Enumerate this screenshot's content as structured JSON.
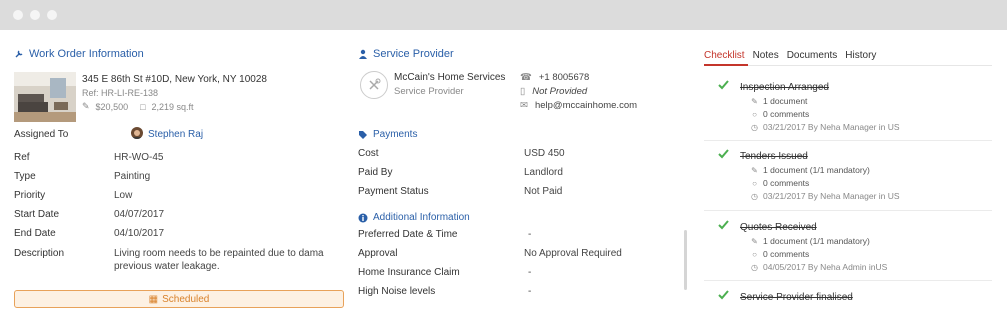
{
  "work_order": {
    "section_title": "Work Order Information",
    "address": "345 E 86th St #10D, New York, NY 10028",
    "ref_line": "Ref: HR-LI-RE-138",
    "price": "$20,500",
    "area": "2,219 sq.ft",
    "fields": [
      {
        "label": "Assigned To",
        "value": "Stephen Raj"
      },
      {
        "label": "Ref",
        "value": "HR-WO-45"
      },
      {
        "label": "Type",
        "value": "Painting"
      },
      {
        "label": "Priority",
        "value": "Low"
      },
      {
        "label": "Start Date",
        "value": "04/07/2017"
      },
      {
        "label": "End Date",
        "value": "04/10/2017"
      },
      {
        "label": "Description",
        "value": "Living room needs to be repainted due to damage fr",
        "value2": "previous water leakage."
      }
    ],
    "status_button": "Scheduled"
  },
  "service_provider": {
    "section_title": "Service Provider",
    "name": "McCain's Home Services",
    "role": "Service Provider",
    "phone": "+1 8005678",
    "mobile": "Not Provided",
    "email": "help@mccainhome.com"
  },
  "payments": {
    "section_title": "Payments",
    "rows": [
      {
        "label": "Cost",
        "value": "USD 450"
      },
      {
        "label": "Paid By",
        "value": "Landlord"
      },
      {
        "label": "Payment Status",
        "value": "Not Paid"
      }
    ]
  },
  "additional": {
    "section_title": "Additional Information",
    "rows": [
      {
        "label": "Preferred Date & Time",
        "value": "-"
      },
      {
        "label": "Approval",
        "value": "No Approval Required"
      },
      {
        "label": "Home Insurance Claim",
        "value": "-"
      },
      {
        "label": "High Noise levels",
        "value": "-"
      }
    ]
  },
  "tabs": [
    "Checklist",
    "Notes",
    "Documents",
    "History"
  ],
  "checklist": [
    {
      "title": "Inspection Arranged",
      "docs": "1 document",
      "comments": "0 comments",
      "meta": "03/21/2017 By Neha Manager in US"
    },
    {
      "title": "Tenders Issued",
      "docs": "1 document (1/1 mandatory)",
      "comments": "0 comments",
      "meta": "03/21/2017 By Neha Manager in US"
    },
    {
      "title": "Quotes Received",
      "docs": "1 document (1/1 mandatory)",
      "comments": "0 comments",
      "meta": "04/05/2017 By Neha Admin inUS"
    },
    {
      "title": "Service Provider finalised"
    }
  ],
  "colors": {
    "accent": "#2a5fa8",
    "check": "#4caf50",
    "tab_active": "#c4352b",
    "scheduled": "#d9822b"
  }
}
